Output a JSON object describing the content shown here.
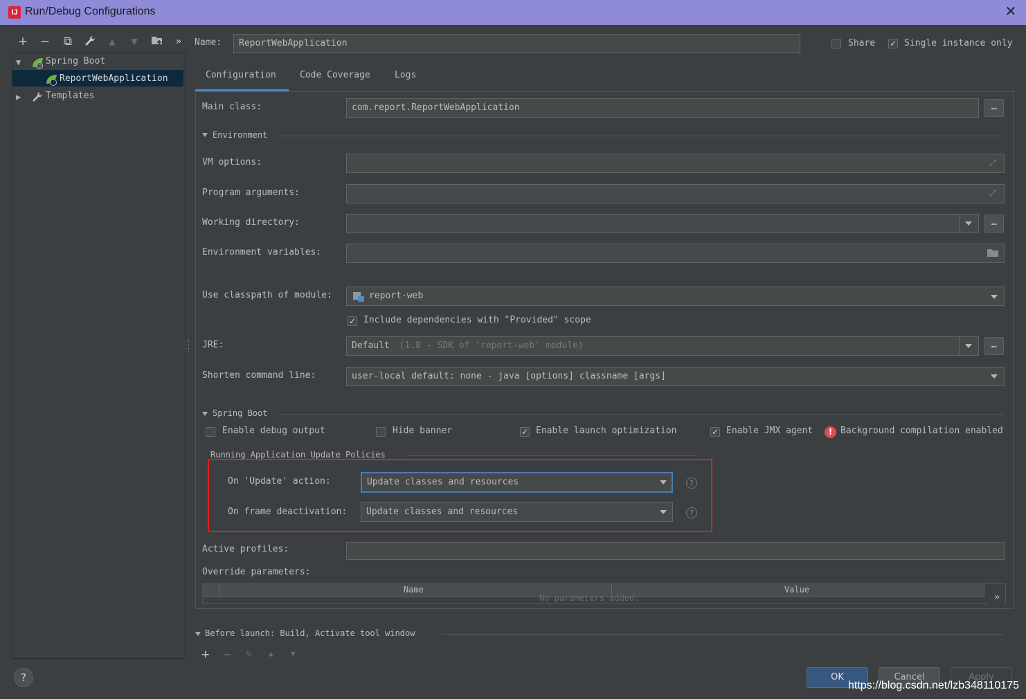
{
  "window": {
    "title": "Run/Debug Configurations",
    "app_icon_text": "IJ"
  },
  "toolbar": {
    "add": "+",
    "remove": "−",
    "copy": "⧉",
    "edit": "🔧",
    "up": "▲",
    "down": "▼",
    "folder": "📁",
    "more": "»"
  },
  "tree": {
    "spring_boot": "Spring Boot",
    "report_web_app": "ReportWebApplication",
    "templates": "Templates"
  },
  "name_label": "Name:",
  "name_value": "ReportWebApplication",
  "share_label": "Share",
  "single_instance_label": "Single instance only",
  "tabs": [
    "Configuration",
    "Code Coverage",
    "Logs"
  ],
  "config": {
    "main_class_label": "Main class:",
    "main_class_value": "com.report.ReportWebApplication",
    "environment_header": "Environment",
    "vm_options_label": "VM options:",
    "program_arguments_label": "Program arguments:",
    "working_directory_label": "Working directory:",
    "environment_variables_label": "Environment variables:",
    "classpath_label": "Use classpath of module:",
    "classpath_value": "report-web",
    "include_deps_label": "Include dependencies with \"Provided\" scope",
    "jre_label": "JRE:",
    "jre_value_default": "Default",
    "jre_value_hint": "(1.8 - SDK of 'report-web' module)",
    "shorten_label": "Shorten command line:",
    "shorten_value": "user-local default: none - java [options] classname [args]",
    "spring_boot_header": "Spring Boot",
    "enable_debug_label": "Enable debug output",
    "hide_banner_label": "Hide banner",
    "enable_launch_label": "Enable launch optimization",
    "enable_jmx_label": "Enable JMX agent",
    "bg_compilation_label": "Background compilation enabled",
    "policies_header": "Running Application Update Policies",
    "on_update_label": "On 'Update' action:",
    "on_update_value": "Update classes and resources",
    "on_frame_label": "On frame deactivation:",
    "on_frame_value": "Update classes and resources",
    "active_profiles_label": "Active profiles:",
    "override_params_label": "Override parameters:",
    "table_col_name": "Name",
    "table_col_value": "Value",
    "table_empty": "No parameters added.",
    "before_launch_label": "Before launch: Build, Activate tool window"
  },
  "buttons": {
    "ok": "OK",
    "cancel": "Cancel",
    "apply": "Apply",
    "help": "?"
  },
  "watermark": "https://blog.csdn.net/lzb348110175",
  "colors": {
    "accent_blue": "#365880",
    "red_highlight": "#e0201e",
    "title_bar": "#8f8bd9",
    "spring_green": "#6db33f"
  }
}
